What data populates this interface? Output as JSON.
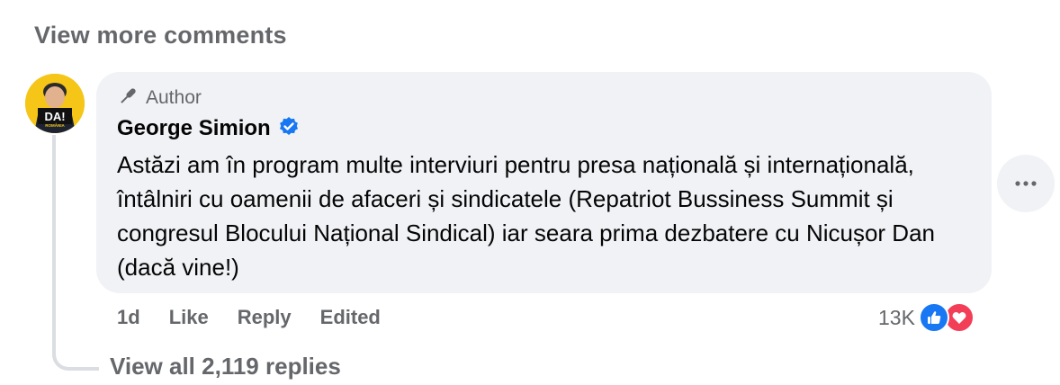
{
  "view_more_comments": "View more comments",
  "comment": {
    "author_badge": "Author",
    "author_name": "George Simion",
    "verified": true,
    "avatar_text": "DA!",
    "avatar_subtext": "ROMÂNIA",
    "text": "Astăzi am în program multe interviuri pentru presa națională și internațională, întâlniri cu oamenii de afaceri și sindicatele (Repatriot Bussiness Summit și congresul Blocului Național Sindical) iar seara prima dezbatere cu Nicușor Dan (dacă vine!)",
    "time": "1d",
    "like_label": "Like",
    "reply_label": "Reply",
    "edited_label": "Edited",
    "reaction_count": "13K",
    "reactions": [
      "like-icon",
      "love-icon"
    ]
  },
  "view_replies": "View all 2,119 replies",
  "colors": {
    "bubble": "#f0f2f5",
    "secondary_text": "#65676b",
    "verified_blue": "#1877f2",
    "like_blue": "#1877f2",
    "love_red": "#f33e58",
    "avatar_yellow": "#f5c518"
  }
}
